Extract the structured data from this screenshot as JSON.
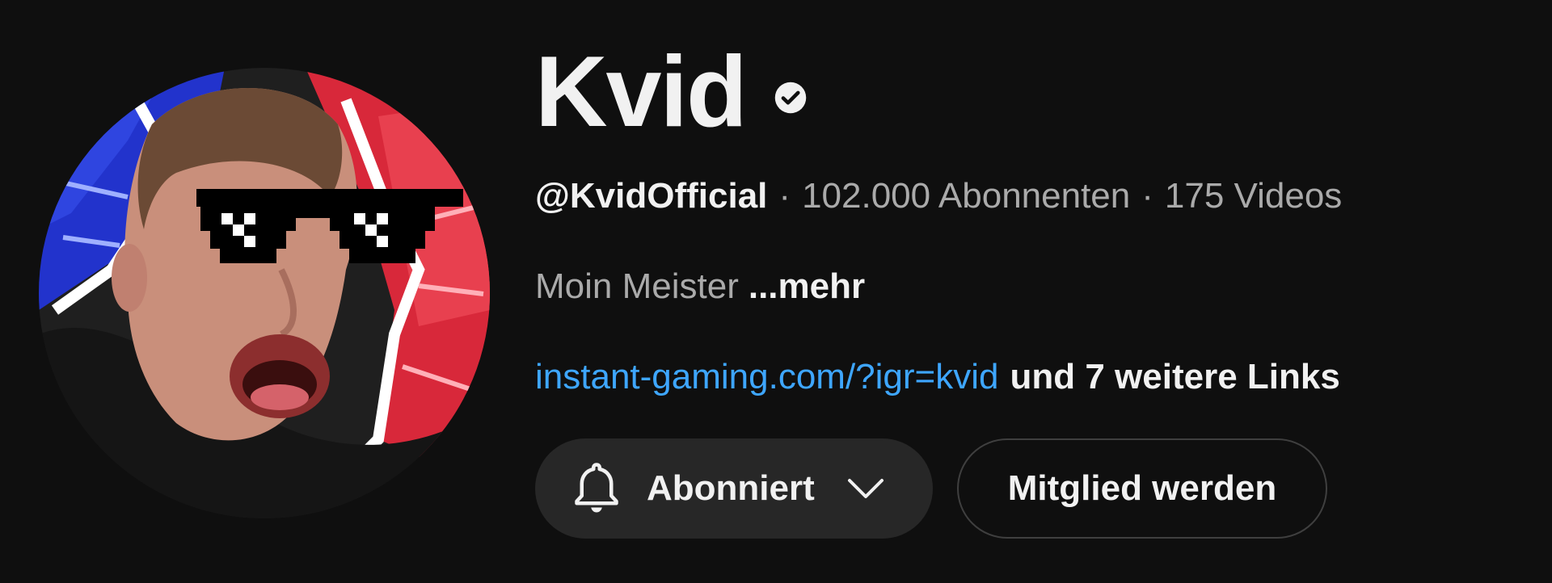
{
  "channel": {
    "name": "Kvid",
    "verified": true,
    "handle": "@KvidOfficial",
    "separator": "·",
    "subscribers": "102.000 Abonnenten",
    "videos": "175 Videos"
  },
  "description": {
    "text": "Moin Meister",
    "more_label": "...mehr"
  },
  "links": {
    "primary": "instant-gaming.com/?igr=kvid",
    "more_label": "und 7 weitere Links"
  },
  "buttons": {
    "subscribed_label": "Abonniert",
    "join_label": "Mitglied werden"
  },
  "icons": {
    "verified": "verified-check-icon",
    "bell": "bell-icon",
    "chevron": "chevron-down-icon"
  },
  "colors": {
    "background": "#0f0f0f",
    "text_primary": "#f1f1f1",
    "text_secondary": "#aaaaaa",
    "link": "#3ea6ff",
    "button_bg": "#272727",
    "button_border": "#3f3f3f"
  }
}
